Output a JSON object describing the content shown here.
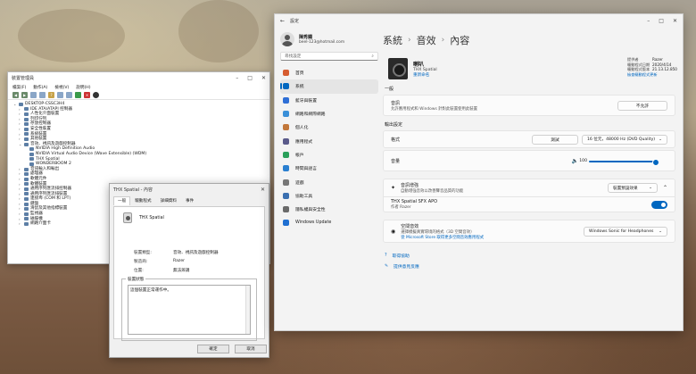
{
  "colors": {
    "accent": "#0067c0",
    "wallpaper": "#8f7761"
  },
  "devmgr": {
    "title": "裝置管理員",
    "menu": [
      "檔案(F)",
      "動作(A)",
      "檢視(V)",
      "說明(H)"
    ],
    "tree": [
      {
        "label": "DESKTOP-CSSC3H4",
        "level": 0,
        "expanded": true
      },
      {
        "label": "IDE ATA/ATAPI 控制器",
        "level": 1
      },
      {
        "label": "人性化介面裝置",
        "level": 1
      },
      {
        "label": "列印佇列",
        "level": 1
      },
      {
        "label": "存放控制器",
        "level": 1
      },
      {
        "label": "安全性裝置",
        "level": 1
      },
      {
        "label": "系統裝置",
        "level": 1
      },
      {
        "label": "其他裝置",
        "level": 1
      },
      {
        "label": "音效、視訊及遊戲控制器",
        "level": 1,
        "expanded": true
      },
      {
        "label": "NVIDIA High Definition Audio",
        "level": 2
      },
      {
        "label": "NVIDIA Virtual Audio Device (Wave Extensible) (WDM)",
        "level": 2
      },
      {
        "label": "THX Spatial",
        "level": 2
      },
      {
        "label": "WONDERBOOM 2",
        "level": 2
      },
      {
        "label": "音訊輸入和輸出",
        "level": 1
      },
      {
        "label": "處理器",
        "level": 1
      },
      {
        "label": "軟體元件",
        "level": 1
      },
      {
        "label": "軟體裝置",
        "level": 1
      },
      {
        "label": "通用序列匯流排控制器",
        "level": 1
      },
      {
        "label": "通用序列匯流排裝置",
        "level": 1
      },
      {
        "label": "連接埠 (COM 和 LPT)",
        "level": 1
      },
      {
        "label": "鍵盤",
        "level": 1
      },
      {
        "label": "滑鼠及其他指標裝置",
        "level": 1
      },
      {
        "label": "監視器",
        "level": 1
      },
      {
        "label": "磁碟機",
        "level": 1
      },
      {
        "label": "網路介面卡",
        "level": 1
      }
    ]
  },
  "props": {
    "title": "THX Spatial - 內容",
    "tabs": [
      "一般",
      "驅動程式",
      "詳細資料",
      "事件"
    ],
    "device_name": "THX Spatial",
    "rows": [
      {
        "k": "裝置類型:",
        "v": "音效、視訊及遊戲控制器"
      },
      {
        "k": "製造商:",
        "v": "Razer"
      },
      {
        "k": "位置:",
        "v": "無法辨識"
      }
    ],
    "status_legend": "裝置狀態",
    "status_text": "這個裝置正常運作中。",
    "ok": "確定",
    "cancel": "取消"
  },
  "settings": {
    "title": "設定",
    "user": {
      "name": "陳秀嫻",
      "email": "beel-123@hotmail.com"
    },
    "search_placeholder": "尋找設定",
    "nav": [
      {
        "label": "首頁",
        "color": "#d65c30"
      },
      {
        "label": "系統",
        "color": "#0067c0",
        "active": true
      },
      {
        "label": "藍牙與裝置",
        "color": "#2f6fd6"
      },
      {
        "label": "網路和網際網路",
        "color": "#3a8fd8"
      },
      {
        "label": "個人化",
        "color": "#c2773a"
      },
      {
        "label": "應用程式",
        "color": "#5a5a8a"
      },
      {
        "label": "帳戶",
        "color": "#2aa05a"
      },
      {
        "label": "時間與語言",
        "color": "#2a7fd0"
      },
      {
        "label": "遊戲",
        "color": "#777"
      },
      {
        "label": "協助工具",
        "color": "#3a6fb0"
      },
      {
        "label": "隱私權與安全性",
        "color": "#6a6a6a"
      },
      {
        "label": "Windows Update",
        "color": "#1f6fd1"
      }
    ],
    "breadcrumb": [
      "系統",
      "音效",
      "內容"
    ],
    "device": {
      "name": "喇叭",
      "subtitle": "THX Spatial",
      "rename": "重新命名"
    },
    "info": [
      {
        "k": "提供者",
        "v": "Razer"
      },
      {
        "k": "驅動程式日期",
        "v": "2020/4/14"
      },
      {
        "k": "驅動程式版本",
        "v": "21.13.12.850"
      }
    ],
    "info_link": "檢查驅動程式更新",
    "general": {
      "label": "一般",
      "audio_title": "音訊",
      "audio_desc": "允許應用程式和 Windows 針對此裝置使用此裝置",
      "disable": "不允許"
    },
    "output": {
      "label": "輸出設定",
      "format": "格式",
      "test": "測試",
      "format_value": "16 位元，48000 Hz (DVD Quality)",
      "volume": "音量",
      "volume_value": "100"
    },
    "enhance": {
      "title": "音訊增強",
      "desc": "自動增強音效以改善聲音品質的功能",
      "value": "裝置預設效果",
      "apo_title": "THX Spatial SFX APO",
      "apo_sub": "作者 Razer"
    },
    "spatial": {
      "title": "空間音效",
      "desc": "選擇模擬真實環境的格式（3D 空間音效）",
      "link": "從 Microsoft Store 取得更多空間音效應用程式",
      "value": "Windows Sonic for Headphones"
    },
    "help": "取得協助",
    "feedback": "提供意見反應"
  }
}
